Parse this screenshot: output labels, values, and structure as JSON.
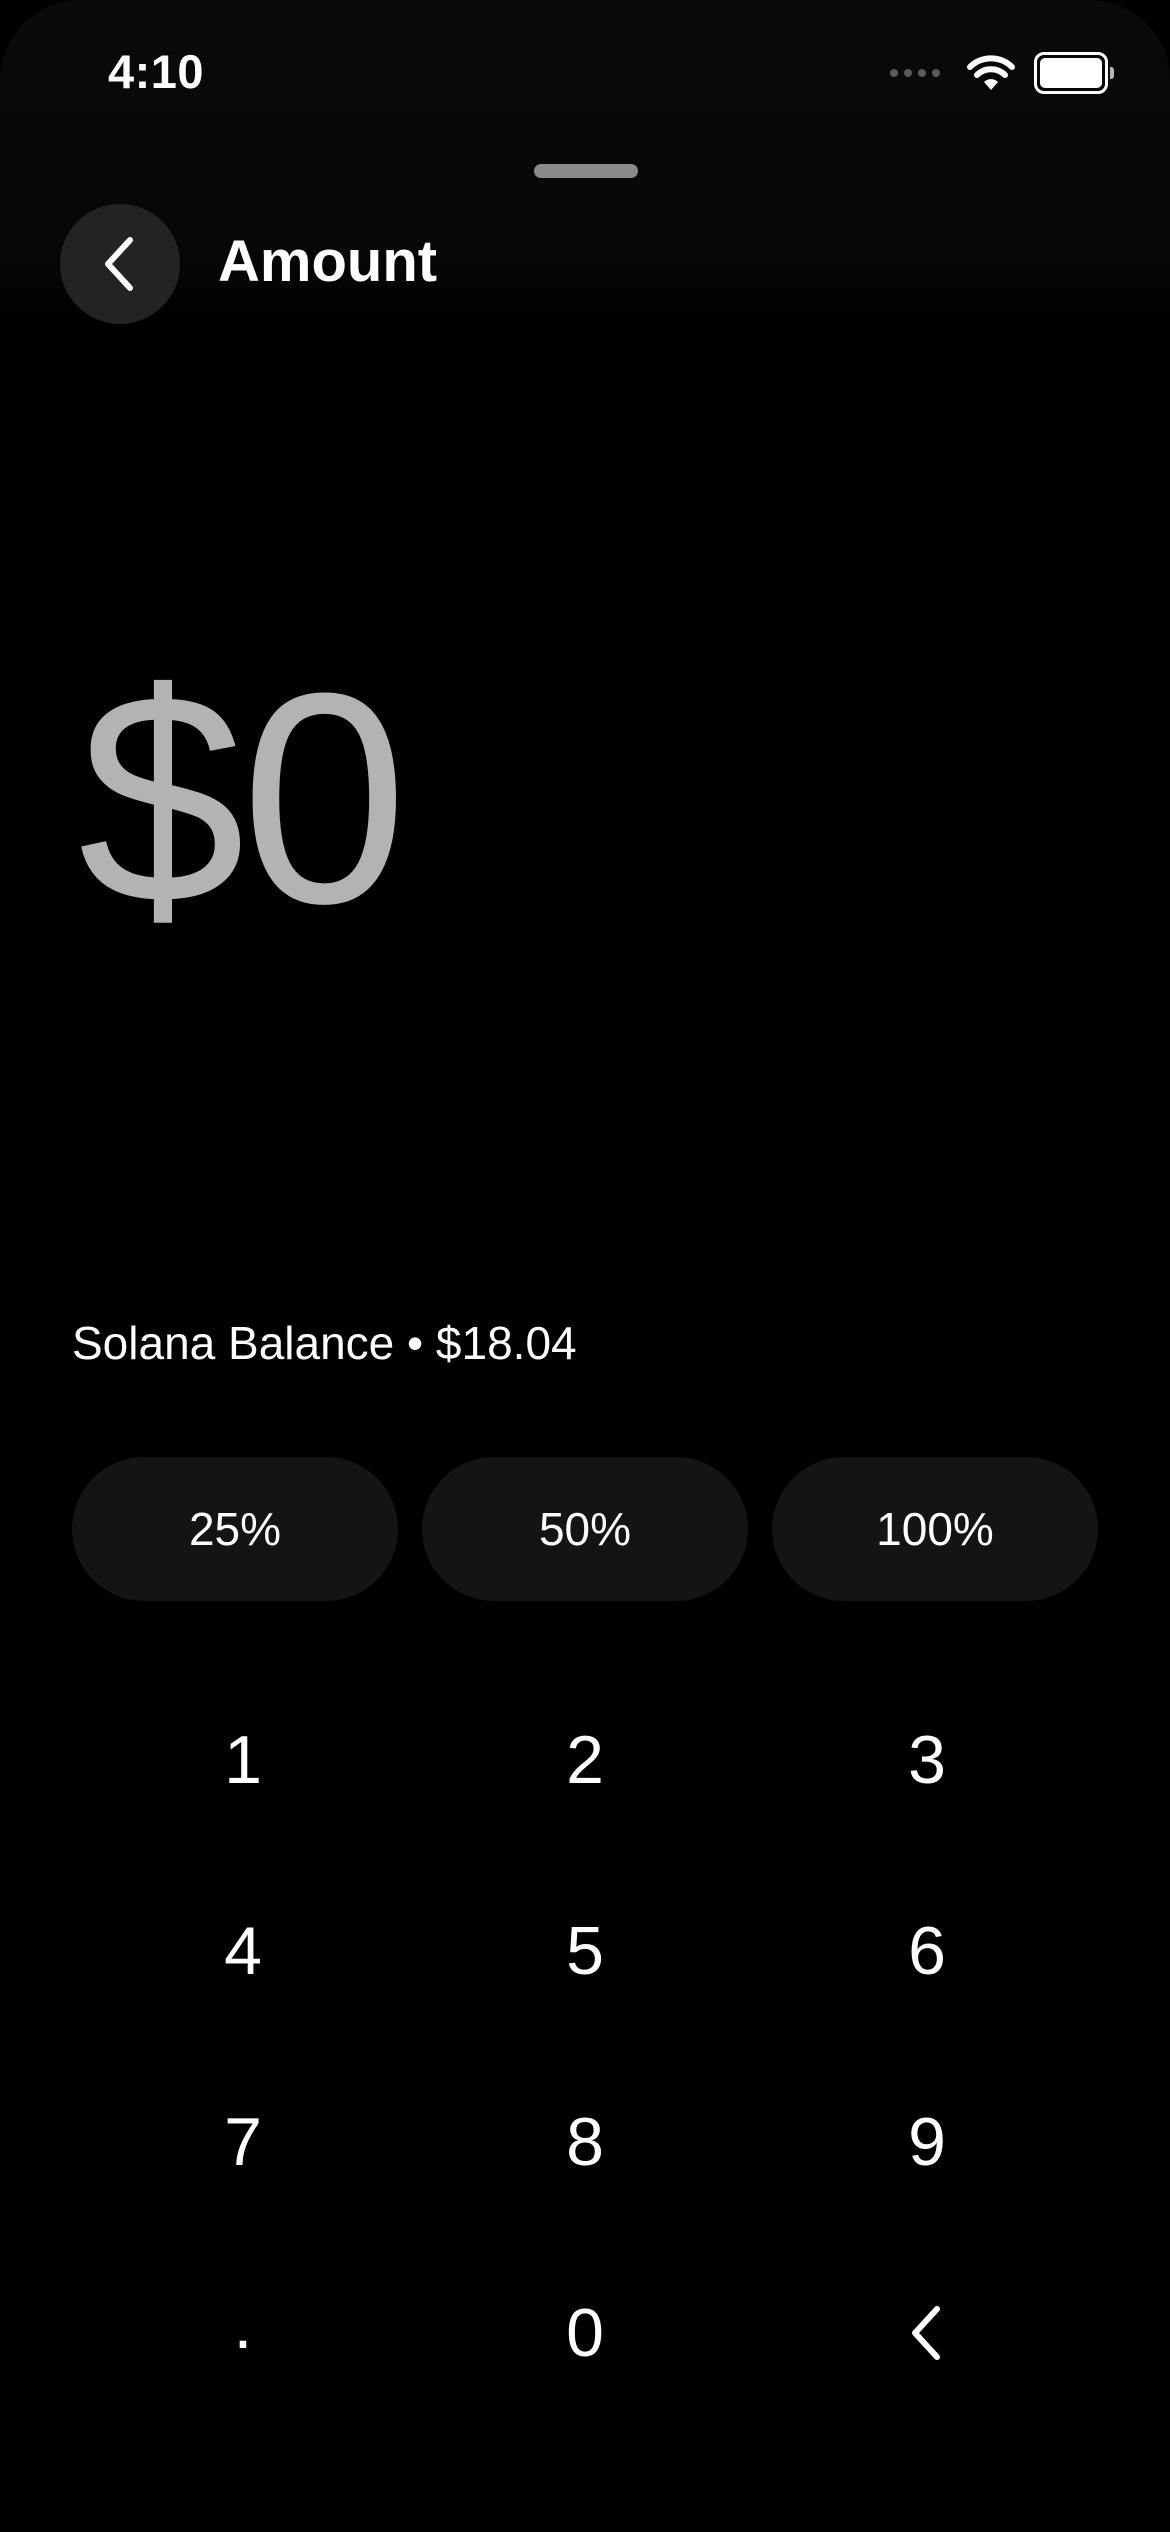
{
  "status_bar": {
    "time": "4:10",
    "icons": [
      "signal-icon",
      "wifi-icon",
      "battery-icon"
    ]
  },
  "header": {
    "title": "Amount",
    "back_icon": "chevron-left-icon"
  },
  "amount": {
    "value": "$0",
    "color": "#b3b3b3"
  },
  "balance": {
    "text": "Solana Balance • $18.04"
  },
  "percent_buttons": [
    {
      "label": "25%"
    },
    {
      "label": "50%"
    },
    {
      "label": "100%"
    }
  ],
  "keypad": {
    "keys": [
      {
        "label": "1"
      },
      {
        "label": "2"
      },
      {
        "label": "3"
      },
      {
        "label": "4"
      },
      {
        "label": "5"
      },
      {
        "label": "6"
      },
      {
        "label": "7"
      },
      {
        "label": "8"
      },
      {
        "label": "9"
      },
      {
        "label": "."
      },
      {
        "label": "0"
      },
      {
        "label": "",
        "icon": "backspace-icon"
      }
    ]
  },
  "colors": {
    "background": "#000000",
    "button_background": "#141414",
    "back_button_background": "#232323",
    "text": "#ffffff"
  }
}
